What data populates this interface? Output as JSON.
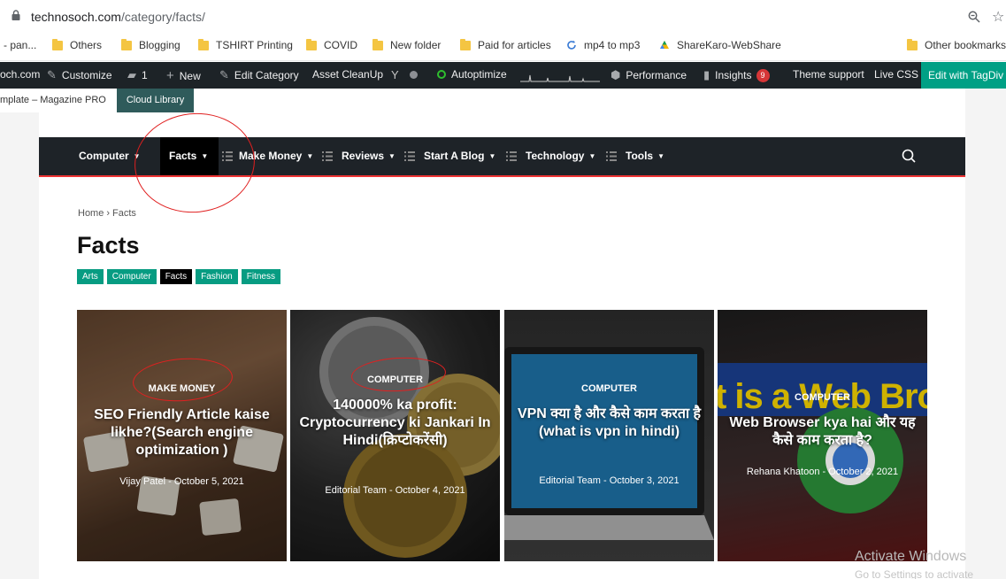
{
  "browser": {
    "url_host": "technosoch.com",
    "url_path": "/category/facts/",
    "bookmarks": [
      {
        "label": "- pan...",
        "icon": "none"
      },
      {
        "label": "Others",
        "icon": "folder-icon"
      },
      {
        "label": "Blogging",
        "icon": "folder-icon"
      },
      {
        "label": "TSHIRT Printing",
        "icon": "folder-icon"
      },
      {
        "label": "COVID",
        "icon": "folder-icon"
      },
      {
        "label": "New folder",
        "icon": "folder-icon"
      },
      {
        "label": "Paid for articles",
        "icon": "folder-icon"
      },
      {
        "label": "mp4 to mp3",
        "icon": "refresh-icon"
      },
      {
        "label": "ShareKaro-WebShare",
        "icon": "drive-icon"
      },
      {
        "label": "Other bookmarks",
        "icon": "folder-icon"
      }
    ]
  },
  "admin_bar": {
    "site": "och.com",
    "customize": "Customize",
    "comments": "1",
    "new": "New",
    "edit_category": "Edit Category",
    "asset_cleanup": "Asset CleanUp",
    "autoptimize": "Autoptimize",
    "performance": "Performance",
    "insights": "Insights",
    "insights_count": "9",
    "theme_support": "Theme support",
    "live_css": "Live CSS",
    "tagdiv": "Edit with TagDiv Composer"
  },
  "template_strip": {
    "label": "mplate – Magazine PRO",
    "button": "Cloud Library"
  },
  "nav": {
    "items": [
      {
        "label": "Computer"
      },
      {
        "label": "Facts"
      },
      {
        "label": "Make Money"
      },
      {
        "label": "Reviews"
      },
      {
        "label": "Start A Blog"
      },
      {
        "label": "Technology"
      },
      {
        "label": "Tools"
      }
    ]
  },
  "breadcrumb": {
    "home": "Home",
    "current": "Facts",
    "separator": "›"
  },
  "title": "Facts",
  "categories": [
    "Arts",
    "Computer",
    "Facts",
    "Fashion",
    "Fitness"
  ],
  "cards": [
    {
      "tag": "MAKE MONEY",
      "title": "SEO Friendly Article kaise likhe?(Search engine optimization )",
      "author": "Vijay Patel",
      "date": "October 5, 2021"
    },
    {
      "tag": "COMPUTER",
      "title": "140000% ka profit: Cryptocurrency ki Jankari In Hindi(क्रिप्टोकरेंसी)",
      "author": "Editorial Team",
      "date": "October 4, 2021"
    },
    {
      "tag": "COMPUTER",
      "title": "VPN क्या है और कैसे काम करता है (what is vpn in hindi)",
      "author": "Editorial Team",
      "date": "October 3, 2021"
    },
    {
      "tag": "COMPUTER",
      "title": "Web Browser kya hai और यह कैसे काम करता है?",
      "author": "Rehana Khatoon",
      "date": "October 2, 2021"
    }
  ],
  "card4_overlay_text": "t is a Web Brow",
  "watermark": {
    "line1": "Activate Windows",
    "line2": "Go to Settings to activate"
  }
}
